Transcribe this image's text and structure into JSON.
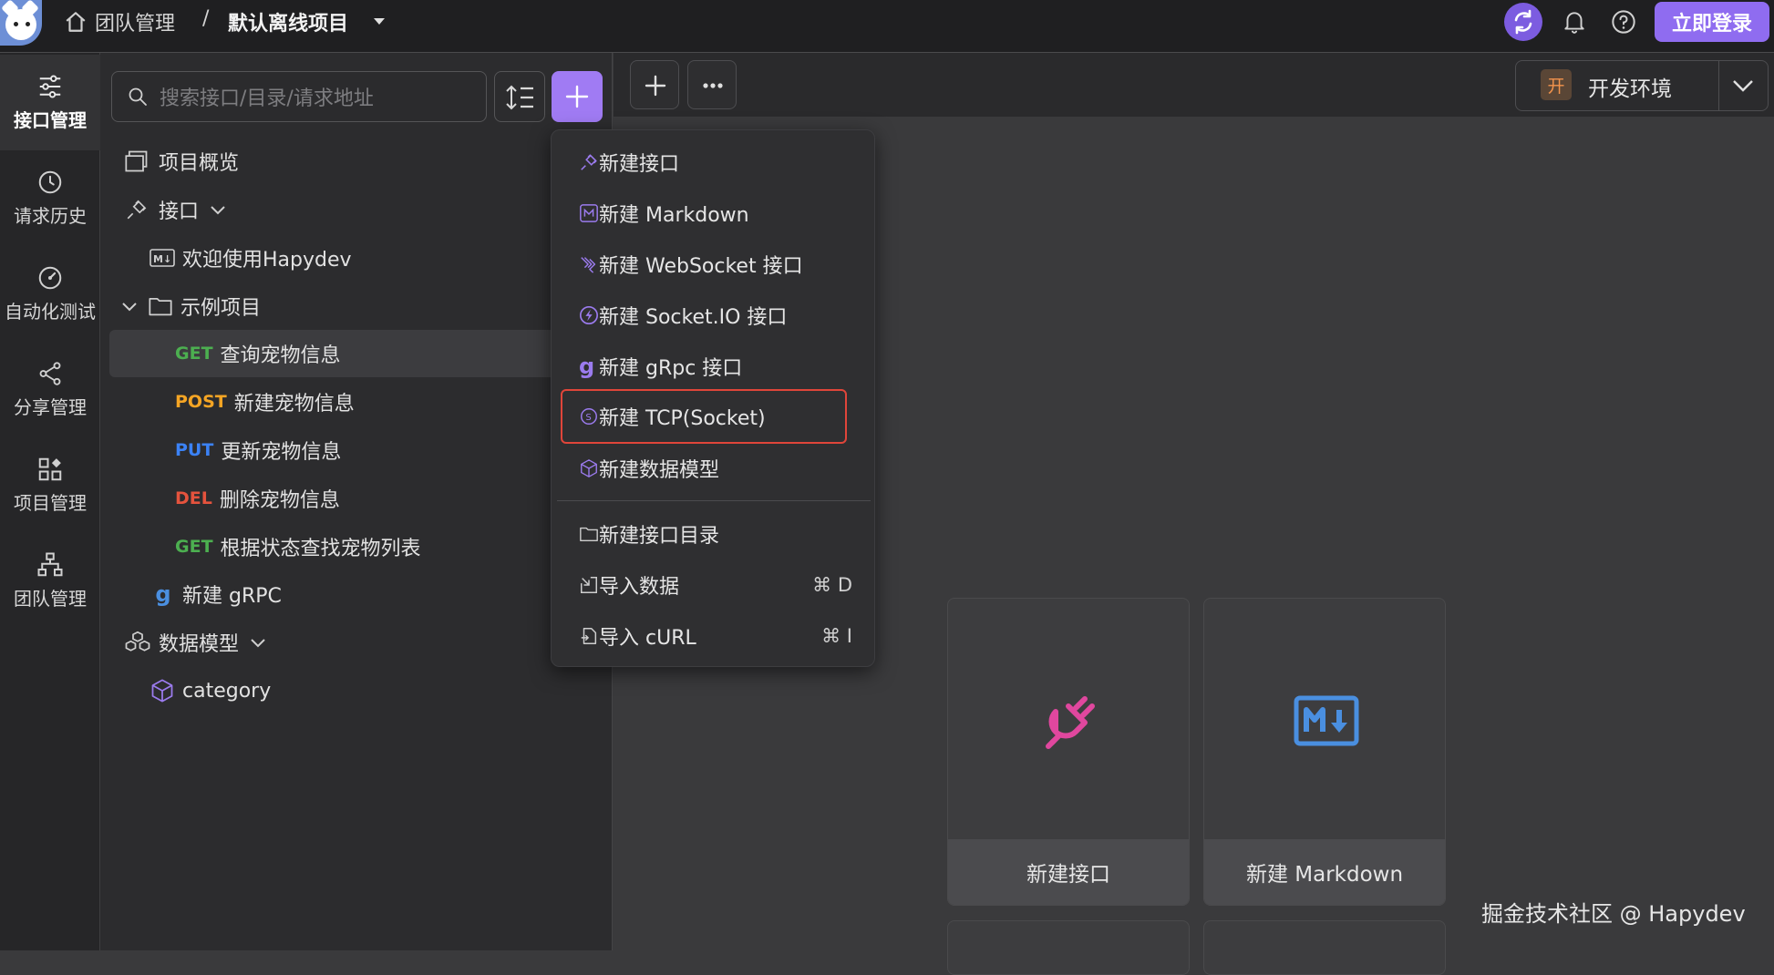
{
  "topbar": {
    "breadcrumb_team": "团队管理",
    "separator": "/",
    "project": "默认离线项目",
    "login": "立即登录"
  },
  "rail": {
    "items": [
      {
        "label": "接口管理",
        "icon": "sliders-icon",
        "active": true
      },
      {
        "label": "请求历史",
        "icon": "clock-icon"
      },
      {
        "label": "自动化测试",
        "icon": "gauge-icon"
      },
      {
        "label": "分享管理",
        "icon": "share-icon"
      },
      {
        "label": "项目管理",
        "icon": "grid-icon"
      },
      {
        "label": "团队管理",
        "icon": "org-icon"
      }
    ]
  },
  "tree": {
    "search_placeholder": "搜索接口/目录/请求地址",
    "overview": "项目概览",
    "api_group": "接口",
    "welcome": "欢迎使用Hapydev",
    "folder": "示例项目",
    "endpoints": [
      {
        "method": "GET",
        "name": "查询宠物信息",
        "color": "#4caf50"
      },
      {
        "method": "POST",
        "name": "新建宠物信息",
        "color": "#f5a524"
      },
      {
        "method": "PUT",
        "name": "更新宠物信息",
        "color": "#3b82f6"
      },
      {
        "method": "DEL",
        "name": "删除宠物信息",
        "color": "#e5533d"
      },
      {
        "method": "GET",
        "name": "根据状态查找宠物列表",
        "color": "#4caf50"
      }
    ],
    "grpc": "新建 gRPC",
    "models": "数据模型",
    "model_item": "category"
  },
  "env": {
    "badge": "开",
    "label": "开发环境"
  },
  "menu": {
    "items": [
      {
        "label": "新建接口",
        "icon": "plug-icon"
      },
      {
        "label": "新建 Markdown",
        "icon": "markdown-icon"
      },
      {
        "label": "新建 WebSocket 接口",
        "icon": "websocket-icon"
      },
      {
        "label": "新建 Socket.IO 接口",
        "icon": "socketio-icon"
      },
      {
        "label": "新建 gRpc 接口",
        "icon": "grpc-icon"
      },
      {
        "label": "新建 TCP(Socket)",
        "icon": "tcp-icon",
        "highlighted": true
      },
      {
        "label": "新建数据模型",
        "icon": "cube-icon"
      },
      {
        "label": "新建接口目录",
        "icon": "folder-icon"
      },
      {
        "label": "导入数据",
        "icon": "import-icon",
        "shortcut": "⌘ D"
      },
      {
        "label": "导入 cURL",
        "icon": "curl-icon",
        "shortcut": "⌘ I"
      }
    ]
  },
  "cards": {
    "api": "新建接口",
    "markdown": "新建 Markdown"
  },
  "watermark": "掘金技术社区 @ Hapydev",
  "colors": {
    "accent": "#8f6cf0",
    "highlight": "#e0453a",
    "plug": "#e0479e",
    "markdown": "#4a8fe0"
  }
}
